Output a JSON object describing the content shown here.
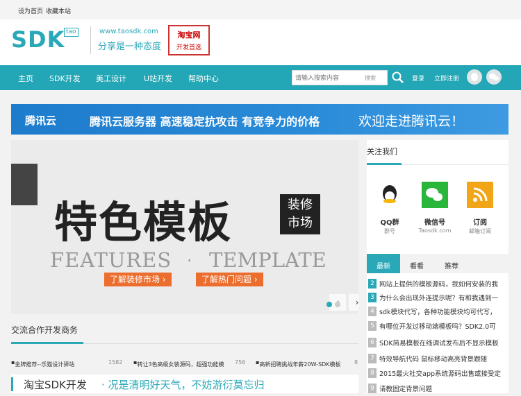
{
  "topbar": {
    "set_home": "设为首页",
    "bookmark": "收藏本站"
  },
  "header": {
    "logo_text": "SDK",
    "logo_tag": "tao",
    "site_url": "www.taosdk.com",
    "slogan": "分享是一种态度",
    "badge_line1": "淘宝网",
    "badge_line2": "开发首选"
  },
  "nav": {
    "items": [
      "主页",
      "SDK开发",
      "美工设计",
      "U站开发",
      "帮助中心"
    ],
    "search_placeholder": "请输入搜索内容",
    "search_button": "搜索",
    "login": "登录",
    "register": "立即注册"
  },
  "banner": {
    "brand": "腾讯云",
    "text": "腾讯云服务器 高速稳定抗攻击 有竞争力的价格",
    "text2": "欢迎走进腾讯云！"
  },
  "slider": {
    "title": "特色模板",
    "tag_line1": "装修",
    "tag_line2": "市场",
    "eng1": "FEATURES",
    "eng2": "TEMPLATE",
    "btn1": "了解装修市场 ›",
    "btn2": "了解热门问题 ›"
  },
  "side": {
    "title": "关注我们",
    "follows": [
      {
        "name": "QQ群",
        "sub": "群号",
        "icon": "qq-icon"
      },
      {
        "name": "微信号",
        "sub": "Taosdk.com",
        "icon": "wechat-icon"
      },
      {
        "name": "订阅",
        "sub": "邮箱订阅",
        "icon": "rss-icon"
      }
    ],
    "tabs": [
      "最新",
      "看看",
      "推荐"
    ],
    "news": [
      "网站上提供的模板源码，我如何安装的我",
      "为什么会出现外连提示呢？有和我遇到一",
      "sdk模块代写，各种功能模块均可代写，",
      "有哪位开发过移动端模板吗？SDK2.0可",
      "SDK简易模板在线调试发布后不显示模板",
      "特效导航代码 鼠标移动高亮背景跟随",
      "2015最火社交app系统源码出售或接受定",
      "请教固定背景问题"
    ]
  },
  "section": {
    "title": "交流合作开发商务",
    "links": [
      {
        "text": "金牌推荐--乐猫设计驿站",
        "count": "1582"
      },
      {
        "text": "转让3色高级女装源码，超强功能模",
        "count": "756"
      },
      {
        "text": "高新招聘挑战年薪20W-SDK模板",
        "count": "8"
      }
    ]
  },
  "bottom": {
    "t1": "淘宝SDK开发",
    "t2": "· 况是清明好天气，不妨游衍莫忘归"
  }
}
